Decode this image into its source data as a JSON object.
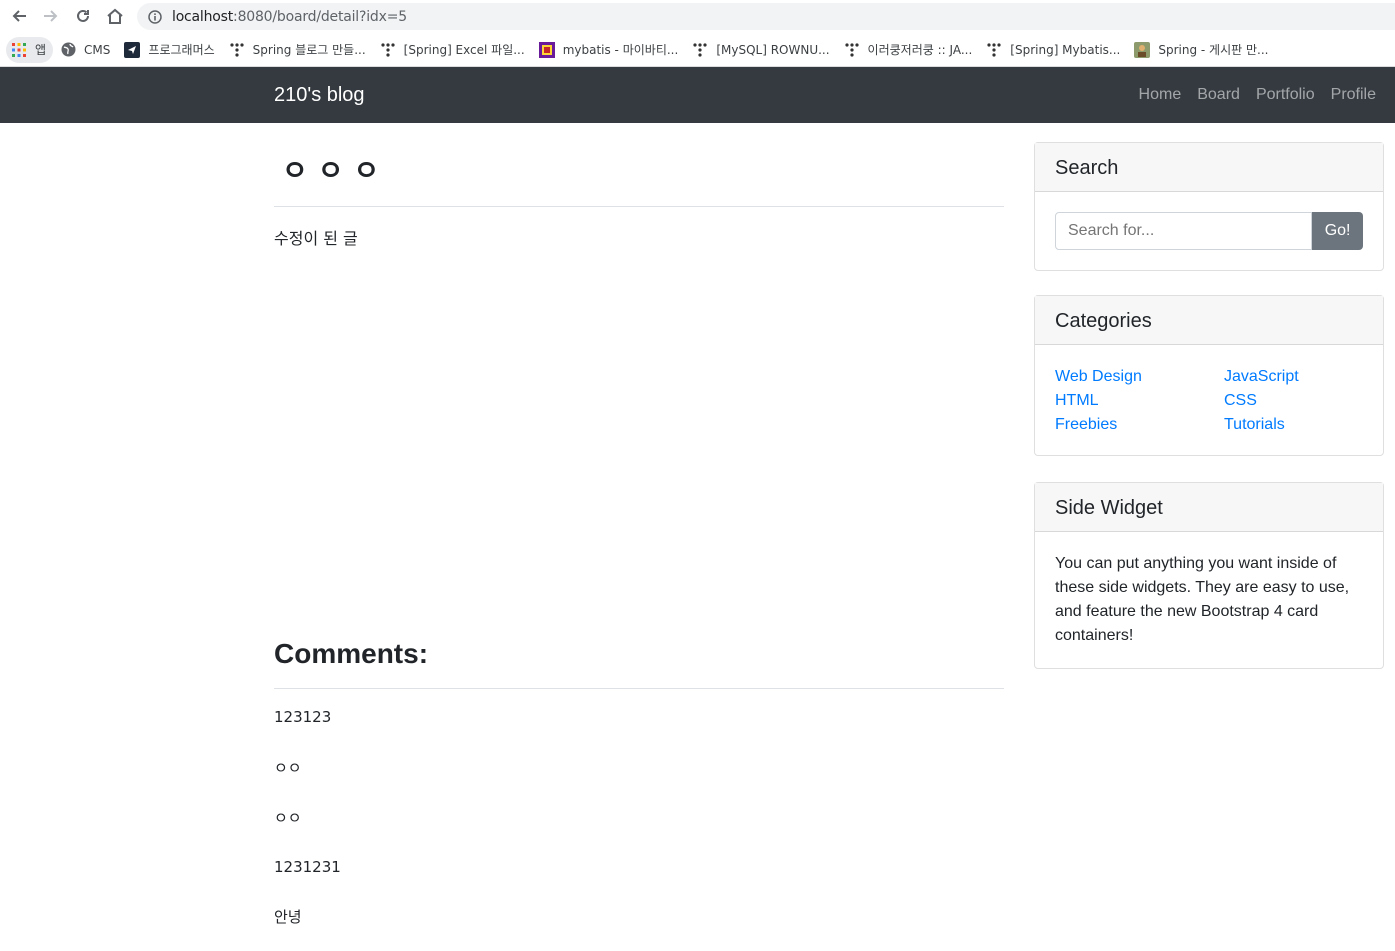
{
  "browser": {
    "url_host": "localhost",
    "url_rest": ":8080/board/detail?idx=5",
    "bookmarks": [
      {
        "label": "앱",
        "icon": "apps-grid-icon"
      },
      {
        "label": "CMS",
        "icon": "globe-icon"
      },
      {
        "label": "프로그래머스",
        "icon": "programmers-icon"
      },
      {
        "label": "Spring 블로그 만들...",
        "icon": "tistory-icon"
      },
      {
        "label": "[Spring] Excel 파일...",
        "icon": "tistory-icon"
      },
      {
        "label": "mybatis - 마이바티...",
        "icon": "mybatis-icon"
      },
      {
        "label": "[MySQL] ROWNU...",
        "icon": "tistory-icon"
      },
      {
        "label": "이러쿵저러쿵 :: JA...",
        "icon": "tistory-icon"
      },
      {
        "label": "[Spring] Mybatis...",
        "icon": "tistory-icon"
      },
      {
        "label": "Spring - 게시판 만...",
        "icon": "image-favicon-icon"
      }
    ]
  },
  "navbar": {
    "brand": "210's blog",
    "links": [
      "Home",
      "Board",
      "Portfolio",
      "Profile"
    ]
  },
  "post": {
    "title": "ㅇㅇㅇ",
    "body": "수정이 된 글"
  },
  "comments": {
    "heading": "Comments:",
    "items": [
      "123123",
      "ㅇㅇ",
      "ㅇㅇ",
      "1231231",
      "안녕"
    ]
  },
  "sidebar": {
    "search": {
      "title": "Search",
      "placeholder": "Search for...",
      "button": "Go!"
    },
    "categories": {
      "title": "Categories",
      "items": [
        "Web Design",
        "JavaScript",
        "HTML",
        "CSS",
        "Freebies",
        "Tutorials"
      ]
    },
    "widget": {
      "title": "Side Widget",
      "text": "You can put anything you want inside of these side widgets. They are easy to use, and feature the new Bootstrap 4 card containers!"
    }
  }
}
